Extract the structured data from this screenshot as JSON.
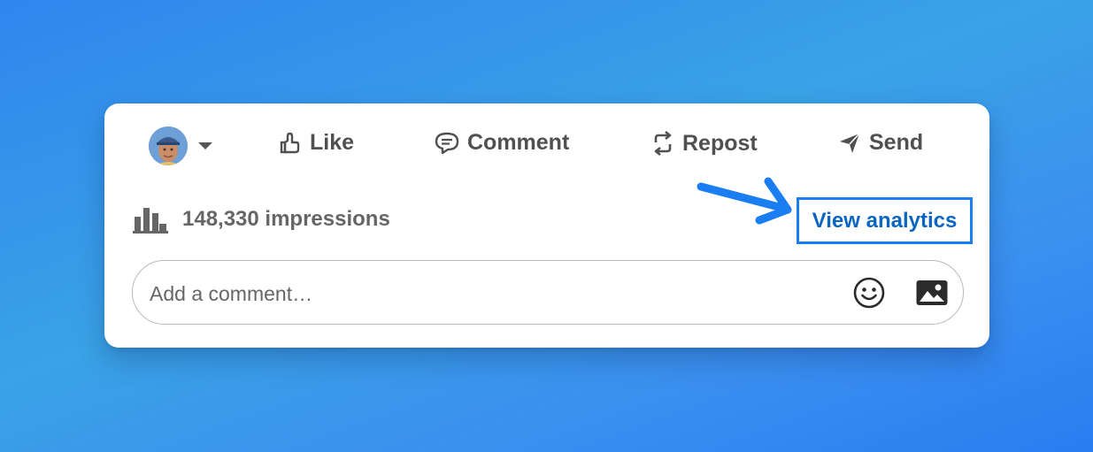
{
  "post_actions": {
    "like_label": "Like",
    "comment_label": "Comment",
    "repost_label": "Repost",
    "send_label": "Send"
  },
  "stats": {
    "impressions_text": "148,330 impressions",
    "view_analytics_label": "View analytics"
  },
  "comment": {
    "placeholder": "Add a comment…"
  },
  "icons": {
    "avatar": "user-avatar",
    "caret": "caret-down-icon",
    "like": "thumbs-up-icon",
    "comment": "speech-bubble-icon",
    "repost": "repost-icon",
    "send": "paper-plane-icon",
    "analytics": "bar-chart-icon",
    "emoji": "smiley-icon",
    "image": "image-icon"
  },
  "colors": {
    "link": "#0a66c2",
    "highlight": "#1a7ef2",
    "text": "#505050"
  }
}
